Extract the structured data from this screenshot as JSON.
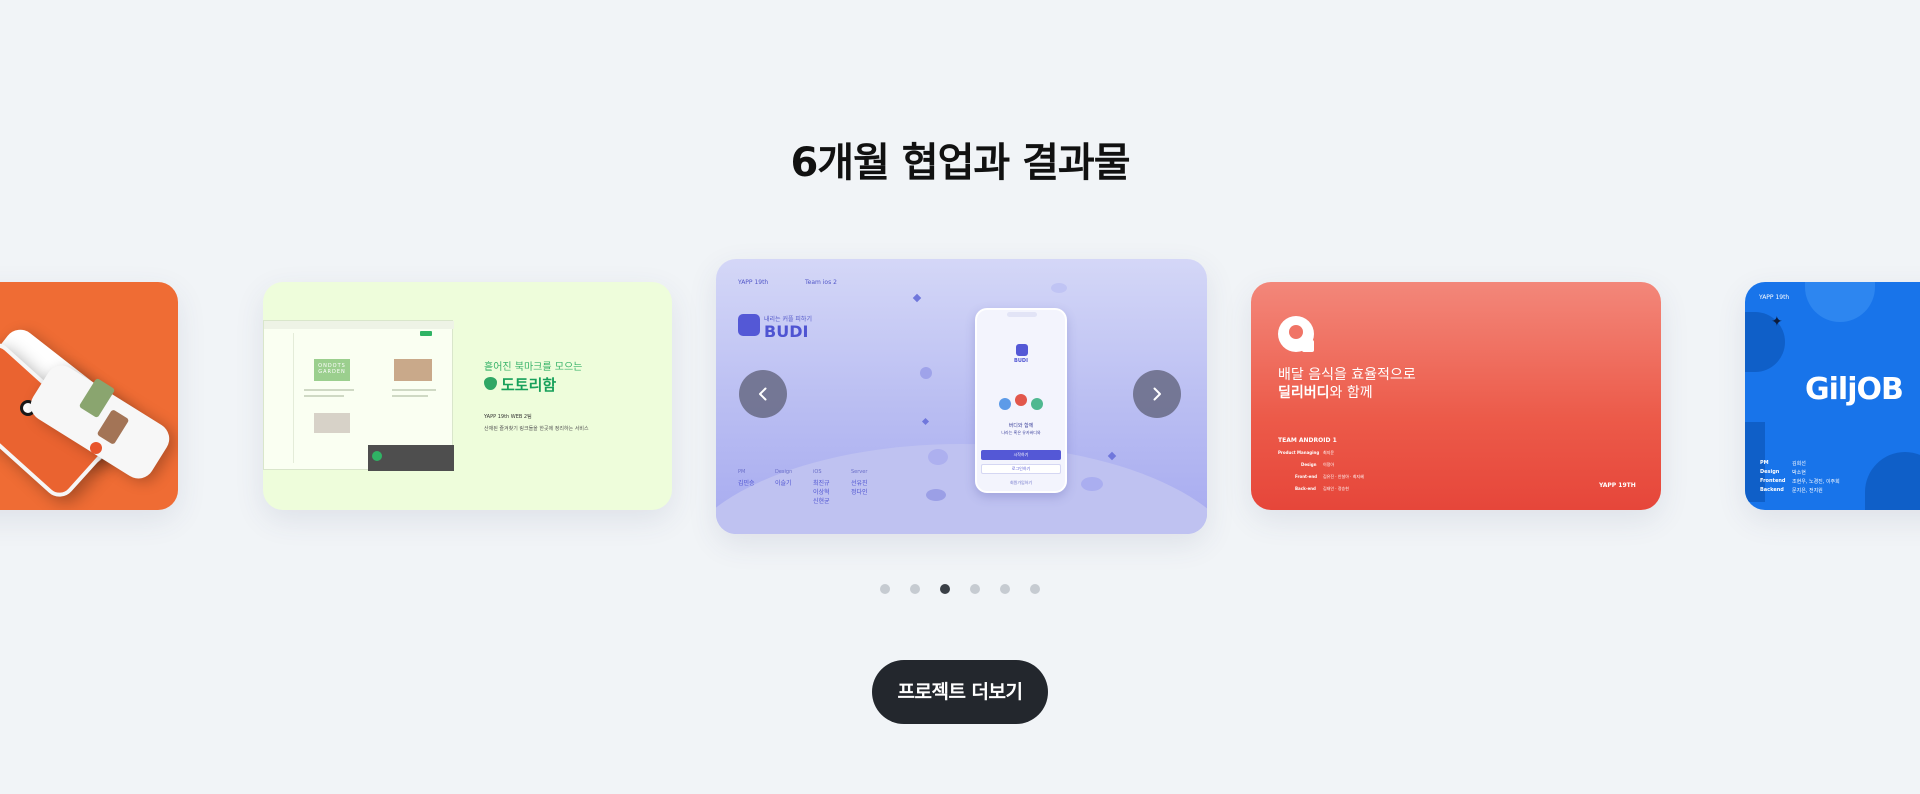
{
  "section": {
    "title": "6개월 협업과 결과물"
  },
  "slides": {
    "dotori": {
      "tagline": "흩어진 북마크를 모으는",
      "name": "도토리함",
      "team": "YAPP 19th WEB 2팀",
      "description": "산재된 즐겨찾기 링크들을 한곳에 정리하는 서비스",
      "screen_title": "ONDOTS GARDEN"
    },
    "budi": {
      "yapp": "YAPP 19th",
      "team": "Team ios 2",
      "tagline": "내리는 커플 피하기",
      "name": "BUDI",
      "phone_title": "BUDI",
      "phone_line1": "버디와 함께",
      "phone_line2": "나라는 혹은 유카버디와",
      "phone_button": "시작하기",
      "phone_button2": "로그인하기",
      "phone_footer": "회원가입하기",
      "credits": [
        {
          "role": "PM",
          "names": [
            "김민승"
          ]
        },
        {
          "role": "Design",
          "names": [
            "이슬기"
          ]
        },
        {
          "role": "iOS",
          "names": [
            "최진규",
            "이상혁",
            "신현균"
          ]
        },
        {
          "role": "Server",
          "names": [
            "선유진",
            "정다인"
          ]
        }
      ]
    },
    "delivery": {
      "line1": "배달 음식을 효율적으로",
      "line2_bold": "딜리버디",
      "line2_rest": "와 함께",
      "team": "TEAM ANDROID 1",
      "credits": [
        {
          "role": "Product Managing",
          "names": "최지윤"
        },
        {
          "role": "Design",
          "names": "이정아"
        },
        {
          "role": "Front-end",
          "names": "김유진 · 안설아 · 최지혜"
        },
        {
          "role": "Back-end",
          "names": "김태인 · 정승현"
        }
      ],
      "yapp": "YAPP 19TH"
    },
    "giljob": {
      "yapp": "YAPP 19th",
      "name": "GiljOB",
      "credits": [
        {
          "role": "PM",
          "names": "김희선"
        },
        {
          "role": "Design",
          "names": "박소현"
        },
        {
          "role": "Frontend",
          "names": "조현우, 노경진, 이주희"
        },
        {
          "role": "Backend",
          "names": "문지은, 전지원"
        }
      ]
    }
  },
  "carousel": {
    "active_index": 3,
    "dot_count": 6
  },
  "more_button": {
    "label": "프로젝트 더보기"
  }
}
